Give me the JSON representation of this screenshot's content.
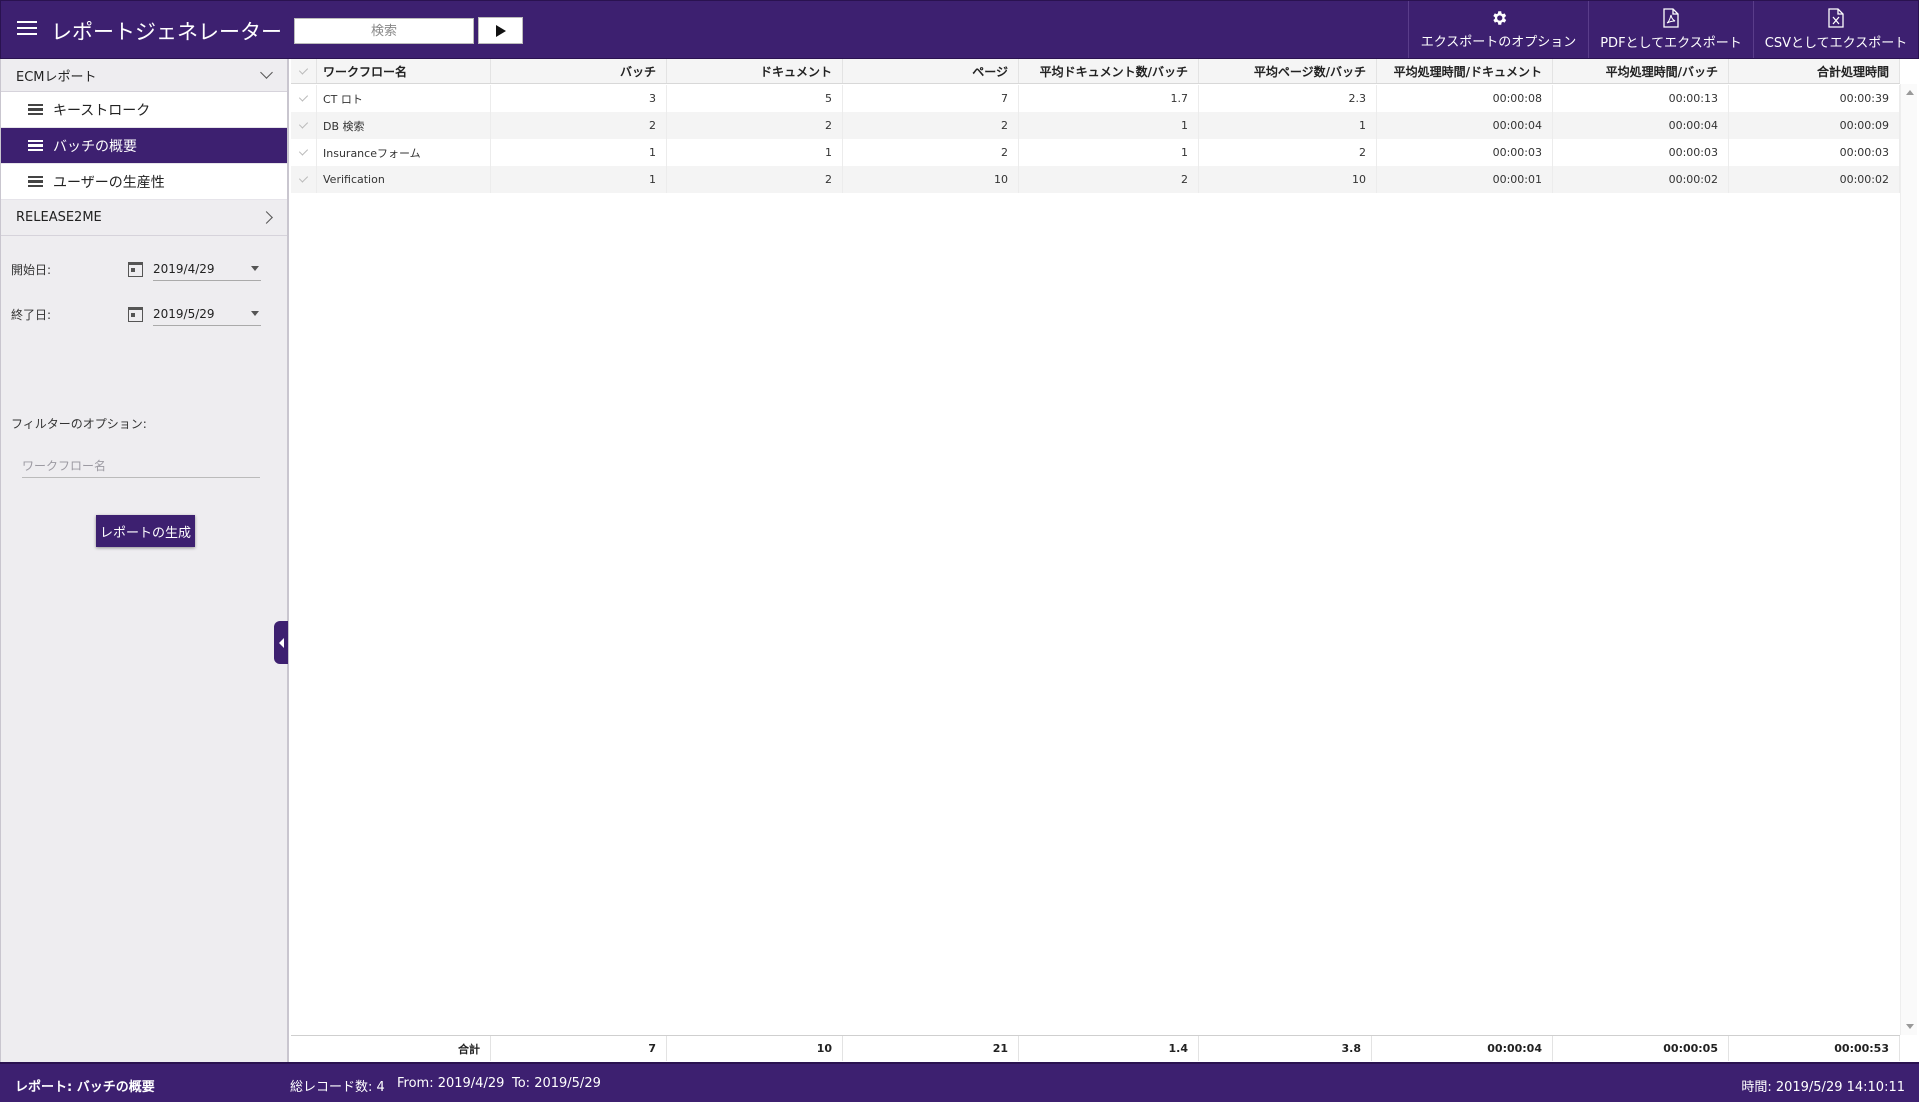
{
  "header": {
    "title": "レポートジェネレーター",
    "search_placeholder": "検索",
    "actions": [
      {
        "label": "エクスポートのオプション",
        "icon": "gear-icon"
      },
      {
        "label": "PDFとしてエクスポート",
        "icon": "pdf-file-icon"
      },
      {
        "label": "CSVとしてエクスポート",
        "icon": "excel-file-icon"
      }
    ]
  },
  "sidebar": {
    "section1": {
      "title": "ECMレポート",
      "items": [
        {
          "label": "キーストローク",
          "active": false
        },
        {
          "label": "バッチの概要",
          "active": true
        },
        {
          "label": "ユーザーの生産性",
          "active": false
        }
      ]
    },
    "section2": {
      "title": "RELEASE2ME"
    },
    "start_label": "開始日:",
    "start_date": "2019/4/29",
    "end_label": "終了日:",
    "end_date": "2019/5/29",
    "filter_label": "フィルターのオプション:",
    "workflow_placeholder": "ワークフロー名",
    "generate_label": "レポートの生成"
  },
  "grid": {
    "columns": [
      "ワークフロー名",
      "バッチ",
      "ドキュメント",
      "ページ",
      "平均ドキュメント数/バッチ",
      "平均ページ数/バッチ",
      "平均処理時間/ドキュメント",
      "平均処理時間/バッチ",
      "合計処理時間"
    ],
    "rows": [
      [
        "CT ロト",
        "3",
        "5",
        "7",
        "1.7",
        "2.3",
        "00:00:08",
        "00:00:13",
        "00:00:39"
      ],
      [
        "DB 検索",
        "2",
        "2",
        "2",
        "1",
        "1",
        "00:00:04",
        "00:00:04",
        "00:00:09"
      ],
      [
        "Insuranceフォーム",
        "1",
        "1",
        "2",
        "1",
        "2",
        "00:00:03",
        "00:00:03",
        "00:00:03"
      ],
      [
        "Verification",
        "1",
        "2",
        "10",
        "2",
        "10",
        "00:00:01",
        "00:00:02",
        "00:00:02"
      ]
    ],
    "footer": [
      "合計",
      "7",
      "10",
      "21",
      "1.4",
      "3.8",
      "00:00:04",
      "00:00:05",
      "00:00:53"
    ]
  },
  "status": {
    "report": "レポート: バッチの概要",
    "record_count": "総レコード数: 4",
    "from": "From: 2019/4/29",
    "to": "To: 2019/5/29",
    "time": "時間: 2019/5/29 14:10:11"
  },
  "colors": {
    "brand": "#3d2070",
    "background": "#ffffff",
    "sidebar": "#eeedf0"
  }
}
